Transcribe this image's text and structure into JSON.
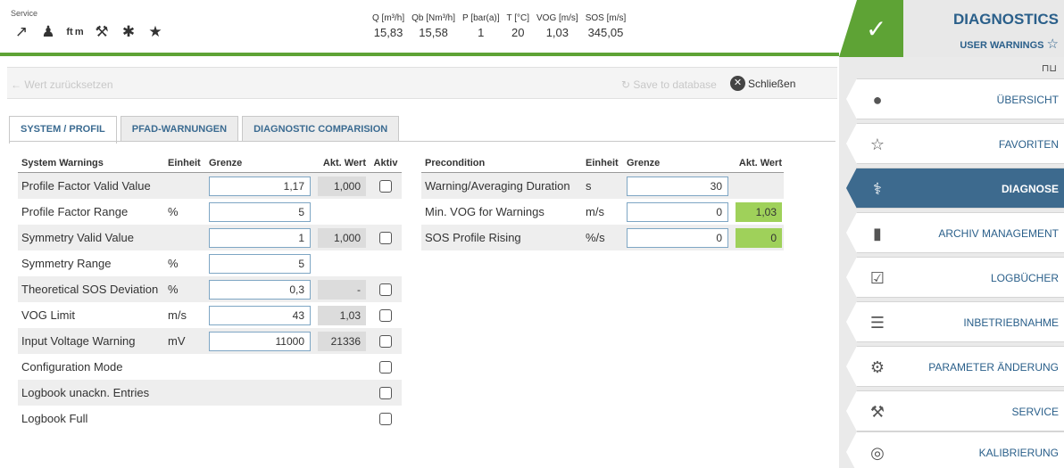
{
  "header": {
    "service_label": "Service",
    "icons": [
      "plug-icon",
      "user-list-icon",
      "ft-m-icon",
      "tools-icon",
      "snowflake-icon",
      "award-icon"
    ],
    "ftm_text": "ft m",
    "measures": {
      "headers": [
        "Q [m³/h]",
        "Qb [Nm³/h]",
        "P [bar(a)]",
        "T [°C]",
        "VOG [m/s]",
        "SOS [m/s]"
      ],
      "values": [
        "15,83",
        "15,58",
        "1",
        "20",
        "1,03",
        "345,05"
      ]
    },
    "diagnostics_title": "DIAGNOSTICS",
    "user_warnings": "USER WARNINGS",
    "accent_green": "#5ea335",
    "accent_blue": "#2a5f8a"
  },
  "toolbar": {
    "reset_label": "Wert zurücksetzen",
    "save_label": "Save to database",
    "close_label": "Schließen"
  },
  "tabs": [
    {
      "label": "SYSTEM / PROFIL",
      "active": true
    },
    {
      "label": "PFAD-WARNUNGEN",
      "active": false
    },
    {
      "label": "DIAGNOSTIC COMPARISION",
      "active": false
    }
  ],
  "left_table": {
    "headers": {
      "name": "System Warnings",
      "unit": "Einheit",
      "grenze": "Grenze",
      "akt": "Akt. Wert",
      "aktiv": "Aktiv"
    },
    "rows": [
      {
        "name": "Profile Factor Valid Value",
        "unit": "",
        "grenze": "1,17",
        "akt": "1,000"
      },
      {
        "name": "Profile Factor Range",
        "unit": "%",
        "grenze": "5",
        "akt": ""
      },
      {
        "name": "Symmetry Valid Value",
        "unit": "",
        "grenze": "1",
        "akt": "1,000"
      },
      {
        "name": "Symmetry Range",
        "unit": "%",
        "grenze": "5",
        "akt": ""
      },
      {
        "name": "Theoretical SOS Deviation",
        "unit": "%",
        "grenze": "0,3",
        "akt": "-"
      },
      {
        "name": "VOG Limit",
        "unit": "m/s",
        "grenze": "43",
        "akt": "1,03"
      },
      {
        "name": "Input Voltage Warning",
        "unit": "mV",
        "grenze": "11000",
        "akt": "21336"
      },
      {
        "name": "Configuration Mode",
        "unit": "",
        "grenze": "",
        "akt": ""
      },
      {
        "name": "Logbook unackn. Entries",
        "unit": "",
        "grenze": "",
        "akt": ""
      },
      {
        "name": "Logbook Full",
        "unit": "",
        "grenze": "",
        "akt": ""
      }
    ]
  },
  "right_table": {
    "headers": {
      "name": "Precondition",
      "unit": "Einheit",
      "grenze": "Grenze",
      "akt": "Akt. Wert"
    },
    "rows": [
      {
        "name": "Warning/Averaging Duration",
        "unit": "s",
        "grenze": "30",
        "akt": ""
      },
      {
        "name": "Min. VOG for Warnings",
        "unit": "m/s",
        "grenze": "0",
        "akt": "1,03"
      },
      {
        "name": "SOS Profile Rising",
        "unit": "%/s",
        "grenze": "0",
        "akt": "0"
      }
    ]
  },
  "nav": {
    "items": [
      {
        "label": "ÜBERSICHT",
        "icon": "globe-icon",
        "active": false
      },
      {
        "label": "FAVORITEN",
        "icon": "star-icon",
        "active": false
      },
      {
        "label": "DIAGNOSE",
        "icon": "stethoscope-icon",
        "active": true
      },
      {
        "label": "ARCHIV MANAGEMENT",
        "icon": "archive-icon",
        "active": false
      },
      {
        "label": "LOGBÜCHER",
        "icon": "logbook-icon",
        "active": false
      },
      {
        "label": "INBETRIEBNAHME",
        "icon": "checklist-icon",
        "active": false
      },
      {
        "label": "PARAMETER ÄNDERUNG",
        "icon": "gear-icon",
        "active": false
      },
      {
        "label": "SERVICE",
        "icon": "wrench-icon",
        "active": false
      },
      {
        "label": "KALIBRIERUNG",
        "icon": "calibration-icon",
        "active": false
      }
    ],
    "active_color": "#3d6a8e"
  }
}
